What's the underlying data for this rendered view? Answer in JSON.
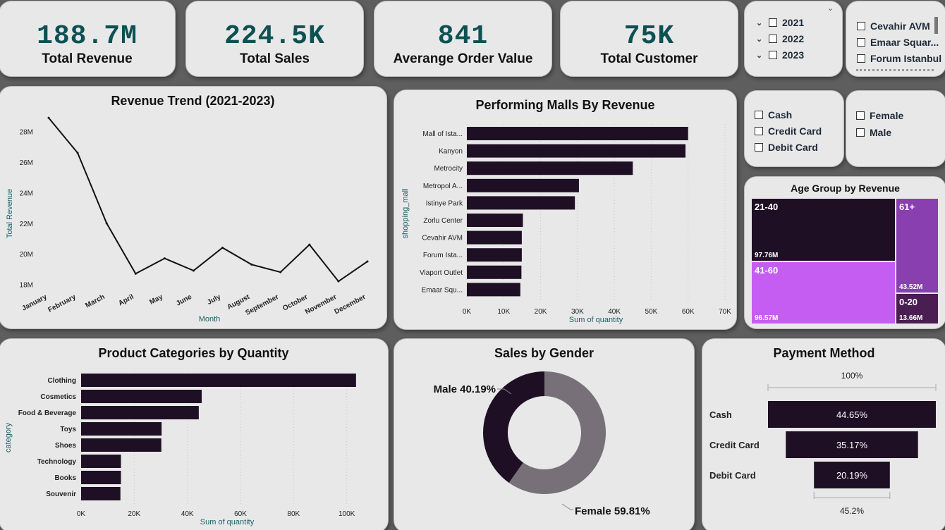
{
  "kpis": [
    {
      "value": "188.7M",
      "label": "Total Revenue"
    },
    {
      "value": "224.5K",
      "label": "Total Sales"
    },
    {
      "value": "841",
      "label": "Averange Order Value"
    },
    {
      "value": "75K",
      "label": "Total Customer"
    }
  ],
  "slicers": {
    "years": [
      "2021",
      "2022",
      "2023"
    ],
    "malls": [
      "Cevahir AVM",
      "Emaar Squar...",
      "Forum Istanbul"
    ],
    "payment": [
      "Cash",
      "Credit Card",
      "Debit Card"
    ],
    "gender": [
      "Female",
      "Male"
    ]
  },
  "colors": {
    "bar": "#1f0f24",
    "line": "#111111",
    "kpi": "#0e5153",
    "donut_male": "#1f0f24",
    "donut_female": "#787078"
  },
  "chart_data": [
    {
      "id": "revenue_trend",
      "type": "line",
      "title": "Revenue Trend (2021-2023)",
      "xlabel": "Month",
      "ylabel": "Total Revenue",
      "x": [
        "January",
        "February",
        "March",
        "April",
        "May",
        "June",
        "July",
        "August",
        "September",
        "October",
        "November",
        "December"
      ],
      "values": [
        28.9,
        26.6,
        22.0,
        18.7,
        19.7,
        18.9,
        20.4,
        19.3,
        18.8,
        20.6,
        18.2,
        19.5
      ],
      "yticks": [
        "18M",
        "20M",
        "22M",
        "24M",
        "26M",
        "28M"
      ],
      "ylim": [
        17.7,
        29.0
      ]
    },
    {
      "id": "malls",
      "type": "bar",
      "title": "Performing Malls By Revenue",
      "xlabel": "Sum of quantity",
      "ylabel": "shopping_mall",
      "categories": [
        "Mall of Ista...",
        "Kanyon",
        "Metrocity",
        "Metropol A...",
        "Istinye Park",
        "Zorlu Center",
        "Cevahir AVM",
        "Forum Ista...",
        "Viaport Outlet",
        "Emaar Squ..."
      ],
      "values": [
        60000,
        59300,
        45000,
        30400,
        29300,
        15200,
        14900,
        14900,
        14800,
        14500
      ],
      "xticks": [
        "0K",
        "10K",
        "20K",
        "30K",
        "40K",
        "50K",
        "60K",
        "70K"
      ],
      "xlim": [
        0,
        70000
      ]
    },
    {
      "id": "age_group",
      "type": "heatmap",
      "title": "Age Group by Revenue",
      "categories": [
        "21-40",
        "41-60",
        "61+",
        "0-20"
      ],
      "values": [
        "97.76M",
        "96.57M",
        "43.52M",
        "13.66M"
      ]
    },
    {
      "id": "categories",
      "type": "bar",
      "title": "Product Categories by Quantity",
      "xlabel": "Sum of quantity",
      "ylabel": "category",
      "categories": [
        "Clothing",
        "Cosmetics",
        "Food & Beverage",
        "Toys",
        "Shoes",
        "Technology",
        "Books",
        "Souvenir"
      ],
      "values": [
        103500,
        45400,
        44300,
        30300,
        30200,
        15000,
        15000,
        14800
      ],
      "xticks": [
        "0K",
        "20K",
        "40K",
        "60K",
        "80K",
        "100K"
      ],
      "xlim": [
        0,
        120000
      ]
    },
    {
      "id": "gender",
      "type": "pie",
      "title": "Sales by Gender",
      "categories": [
        "Male",
        "Female"
      ],
      "values": [
        40.19,
        59.81
      ],
      "labels": [
        "Male 40.19%",
        "Female 59.81%"
      ]
    },
    {
      "id": "payment",
      "type": "bar",
      "title": "Payment Method",
      "categories": [
        "Cash",
        "Credit Card",
        "Debit Card"
      ],
      "values": [
        44.65,
        35.17,
        20.19
      ],
      "value_labels": [
        "44.65%",
        "35.17%",
        "20.19%"
      ],
      "top_label": "100%",
      "bottom_label": "45.2%"
    }
  ]
}
